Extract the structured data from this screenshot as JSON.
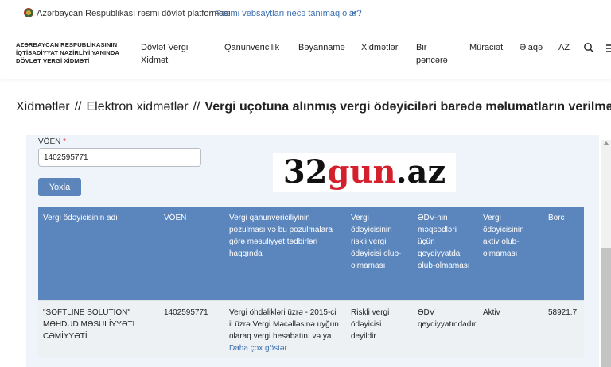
{
  "gov_bar": {
    "text": "Azərbaycan Respublikası rəsmi dövlət platforması",
    "link": "Rəsmi vebsaytları necə tanımaq olar?"
  },
  "header": {
    "ministry": "AZƏRBAYCAN RESPUBLİKASININ İQTİSADİYYAT NAZİRLİYİ YANINDA DÖVLƏT VERGİ XİDMƏTİ",
    "nav": [
      "Dövlət Vergi Xidməti",
      "Qanunvericilik",
      "Bəyannamə",
      "Xidmətlər",
      "Bir pəncərə",
      "Müraciət",
      "Əlaqə",
      "AZ"
    ]
  },
  "breadcrumb": {
    "items": [
      "Xidmətlər",
      "Elektron xidmətlər",
      "Vergi uçotuna alınmış vergi ödəyiciləri barədə məlumatların verilməsi"
    ],
    "separator": "//"
  },
  "form": {
    "voen_label": "VÖEN",
    "required_mark": "*",
    "voen_value": "1402595771",
    "submit_label": "Yoxla"
  },
  "watermark": {
    "part1": "32",
    "part2": "gun",
    "part3": ".az"
  },
  "table": {
    "headers": [
      "Vergi ödəyicisinin adı",
      "VÖEN",
      "Vergi qanunvericiliyinin pozulması və bu pozulmalara görə məsuliyyət tədbirləri haqqında",
      "Vergi ödəyicisinin riskli vergi ödəyicisi olub-olmaması",
      "ƏDV-nin məqsədləri üçün qeydiyyatda olub-olmaması",
      "Vergi ödəyicisinin aktiv olub-olmaması",
      "Borc"
    ],
    "rows": [
      {
        "name": "\"SOFTLINE SOLUTION\" MƏHDUD MƏSULİYYƏTLİ CƏMİYYƏTİ",
        "voen": "1402595771",
        "violations": "Vergi öhdəlikləri üzrə - 2015-ci il üzrə Vergi Məcəlləsinə uyğun olaraq vergi hesabatını və ya",
        "more": "Daha çox göstər",
        "risky": "Riskli vergi ödəyicisi deyildir",
        "vat": "ƏDV qeydiyyatındadır",
        "active": "Aktiv",
        "debt": "58921.7"
      }
    ]
  },
  "colors": {
    "table_header": "#5b86bd",
    "button": "#5c86bb",
    "link": "#3a6fb0",
    "panel": "#eef4fa"
  },
  "icons": [
    "emblem-icon",
    "chevron-down-icon",
    "search-icon",
    "menu-icon"
  ]
}
